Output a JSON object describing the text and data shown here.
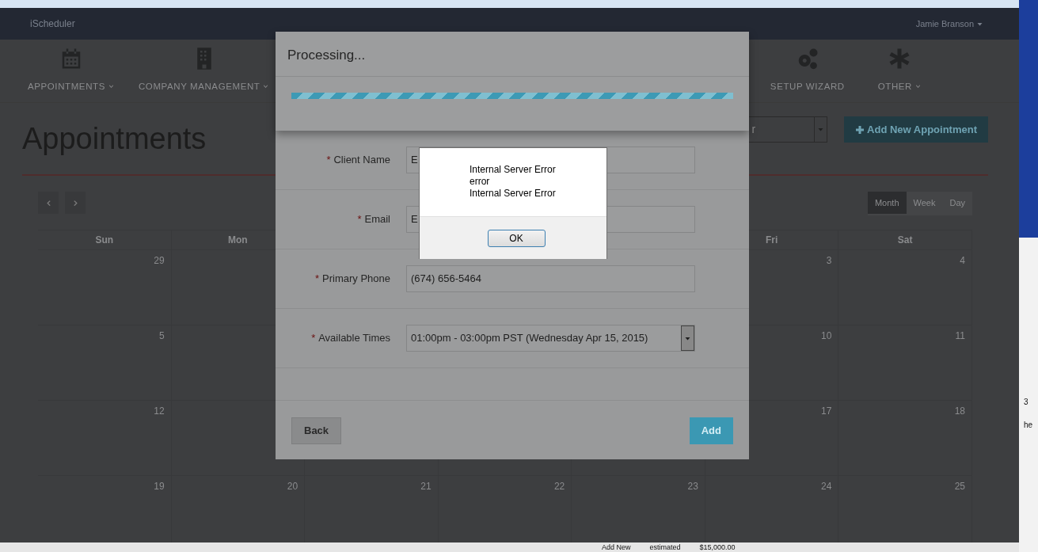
{
  "app": {
    "logo": "iScheduler",
    "user": "Jamie Branson",
    "nav": [
      {
        "label": "APPOINTMENTS",
        "dropdown": true
      },
      {
        "label": "COMPANY MANAGEMENT",
        "dropdown": true
      },
      {
        "label": "SETUP WIZARD",
        "dropdown": false
      },
      {
        "label": "OTHER",
        "dropdown": true
      }
    ]
  },
  "page": {
    "title": "Appointments",
    "filter_select": {
      "value": "r"
    },
    "add_button": "Add New Appointment"
  },
  "calendar": {
    "view_buttons": [
      {
        "label": "Month",
        "selected": true
      },
      {
        "label": "Week",
        "selected": false
      },
      {
        "label": "Day",
        "selected": false
      }
    ],
    "weekdays": {
      "sun": "Sun",
      "mon": "Mon",
      "fri": "Fri",
      "sat": "Sat"
    },
    "weeks": [
      {
        "sun": "29",
        "fri": "3",
        "sat": "4"
      },
      {
        "sun": "5",
        "fri": "10",
        "sat": "11"
      },
      {
        "sun": "12",
        "fri": "17",
        "sat": "18"
      },
      {
        "sun": "19",
        "mon": "20",
        "tue": "21",
        "wed": "22",
        "thu": "23",
        "fri": "24",
        "sat": "25"
      }
    ]
  },
  "processing_dialog": {
    "title": "Processing...",
    "progress": {
      "level": 1
    }
  },
  "appointment_form": {
    "fields": [
      {
        "label": "Client Name",
        "required_mark": "*",
        "kind": "text",
        "value": "E"
      },
      {
        "label": "Email",
        "required_mark": "*",
        "kind": "text",
        "value": "E"
      },
      {
        "label": "Primary Phone",
        "required_mark": "*",
        "kind": "text",
        "value": "(674) 656-5464"
      },
      {
        "label": "Available Times",
        "required_mark": "*",
        "kind": "select",
        "value": "01:00pm - 03:00pm PST (Wednesday Apr 15, 2015)"
      }
    ],
    "buttons": [
      {
        "label": "Back",
        "kind": "secondary"
      },
      {
        "label": "Add",
        "kind": "primary"
      }
    ]
  },
  "alert": {
    "lines": [
      "Internal Server Error",
      "error",
      "Internal Server Error"
    ],
    "button": "OK"
  },
  "desktop": {
    "side_texts": [
      "3",
      "he"
    ],
    "bottom_texts": [
      "Add New",
      "estimated",
      "$15,000.00"
    ]
  }
}
